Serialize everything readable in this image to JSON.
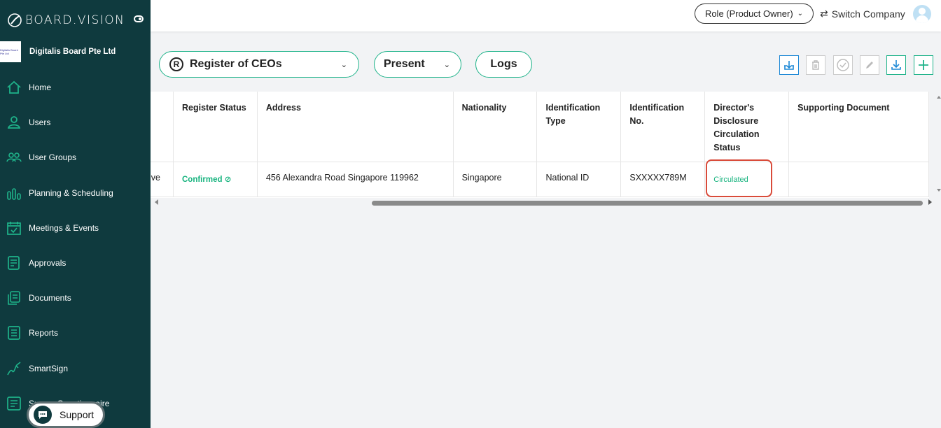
{
  "brand": {
    "name": "BOARD.VISION"
  },
  "company": {
    "name": "Digitalis Board Pte Ltd",
    "logo_text": "Digitalis Board Pte Ltd"
  },
  "sidebar": {
    "items": [
      {
        "label": "Home",
        "icon": "home-icon"
      },
      {
        "label": "Users",
        "icon": "user-icon"
      },
      {
        "label": "User Groups",
        "icon": "users-icon"
      },
      {
        "label": "Planning & Scheduling",
        "icon": "bar-chart-icon"
      },
      {
        "label": "Meetings & Events",
        "icon": "calendar-icon"
      },
      {
        "label": "Approvals",
        "icon": "approval-icon"
      },
      {
        "label": "Documents",
        "icon": "documents-icon"
      },
      {
        "label": "Reports",
        "icon": "reports-icon"
      },
      {
        "label": "SmartSign",
        "icon": "signature-icon"
      },
      {
        "label": "Survey Questionnaire",
        "icon": "survey-icon"
      }
    ],
    "support_label": "Support"
  },
  "topbar": {
    "role_label": "Role (Product Owner)",
    "switch_company_label": "Switch Company"
  },
  "toolbar": {
    "register_badge": "R",
    "register_select": "Register of CEOs",
    "period_select": "Present",
    "logs_label": "Logs"
  },
  "table": {
    "headers": {
      "status": "Register Status",
      "address": "Address",
      "nationality": "Nationality",
      "id_type": "Identification Type",
      "id_no": "Identification No.",
      "disclosure": "Director's Disclosure Circulation Status",
      "supporting": "Supporting Document"
    },
    "row": {
      "truncated": "ve",
      "status": "Confirmed",
      "address": "456 Alexandra Road Singapore 119962",
      "nationality": "Singapore",
      "id_type": "National ID",
      "id_no": "SXXXXX789M",
      "disclosure": "Circulated",
      "supporting": ""
    }
  },
  "colors": {
    "sidebar_bg": "#0f3a3e",
    "accent": "#1fb38a",
    "status_green": "#16b37e",
    "highlight": "#d94b3a",
    "active_tool": "#1d88d6"
  }
}
